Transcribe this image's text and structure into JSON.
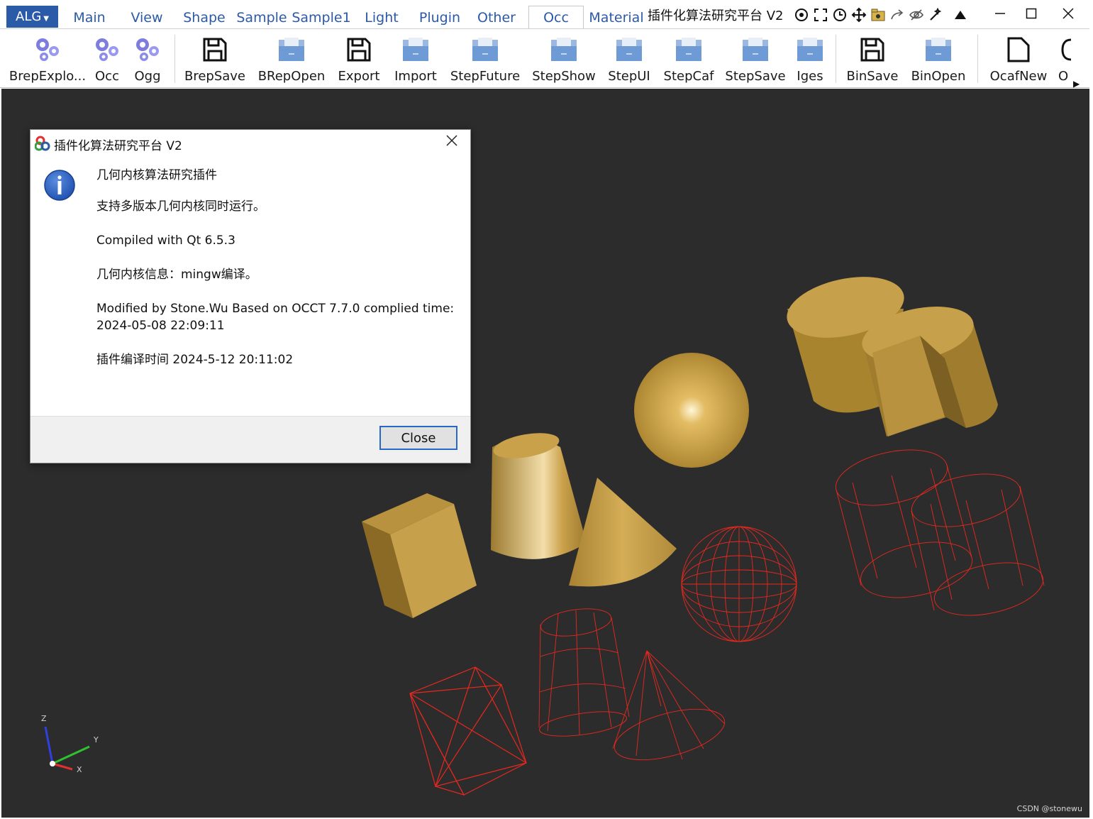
{
  "window": {
    "title": "插件化算法研究平台 V2",
    "menu_button": "ALG",
    "tabs": [
      {
        "label": "Main"
      },
      {
        "label": "View"
      },
      {
        "label": "Shape"
      },
      {
        "label": "Sample"
      },
      {
        "label": "Sample1"
      },
      {
        "label": "Light"
      },
      {
        "label": "Plugin"
      },
      {
        "label": "Other"
      },
      {
        "label": "Occ",
        "active": true
      },
      {
        "label": "Material"
      }
    ],
    "quick_icons": [
      "target-icon",
      "fullscreen-icon",
      "rotate-icon",
      "move-icon",
      "folder-gear-icon",
      "redo-arrow-icon",
      "eye-hidden-icon",
      "wand-icon",
      "triangle-up-icon"
    ]
  },
  "ribbon": {
    "buttons": [
      {
        "label": "BrepExplo...",
        "icon": "gears-icon"
      },
      {
        "label": "Occ",
        "icon": "gears-icon"
      },
      {
        "label": "Ogg",
        "icon": "gears-icon"
      },
      {
        "label": "BrepSave",
        "icon": "save-icon"
      },
      {
        "label": "BRepOpen",
        "icon": "folder-icon"
      },
      {
        "label": "Export",
        "icon": "save-icon"
      },
      {
        "label": "Import",
        "icon": "folder-icon"
      },
      {
        "label": "StepFuture",
        "icon": "folder-icon"
      },
      {
        "label": "StepShow",
        "icon": "folder-icon"
      },
      {
        "label": "StepUI",
        "icon": "folder-icon"
      },
      {
        "label": "StepCaf",
        "icon": "folder-icon"
      },
      {
        "label": "StepSave",
        "icon": "folder-icon"
      },
      {
        "label": "Iges",
        "icon": "folder-icon"
      },
      {
        "label": "BinSave",
        "icon": "save-icon"
      },
      {
        "label": "BinOpen",
        "icon": "folder-icon"
      },
      {
        "label": "OcafNew",
        "icon": "new-document-icon"
      },
      {
        "label": "O",
        "icon": "open-document-icon"
      }
    ]
  },
  "dialog": {
    "title": "插件化算法研究平台 V2",
    "lines": [
      "几何内核算法研究插件",
      "支持多版本几何内核同时运行。",
      "Compiled with Qt 6.5.3",
      "几何内核信息：mingw编译。",
      "Modified by Stone.Wu Based on OCCT 7.7.0 complied time:",
      "2024-05-08 22:09:11",
      "插件编译时间 2024-5-12 20:11:02"
    ],
    "close_button": "Close"
  },
  "viewport": {
    "watermark": "CSDN @stonewu",
    "axes": {
      "x": "X",
      "y": "Y",
      "z": "Z"
    }
  },
  "colors": {
    "accent": "#2b5aa8",
    "viewport_bg": "#2c2c2c",
    "solid_gold": "#c9a040",
    "wireframe_red": "#e8281e",
    "axis_x": "#e03030",
    "axis_y": "#30c030",
    "axis_z": "#3040e0"
  }
}
